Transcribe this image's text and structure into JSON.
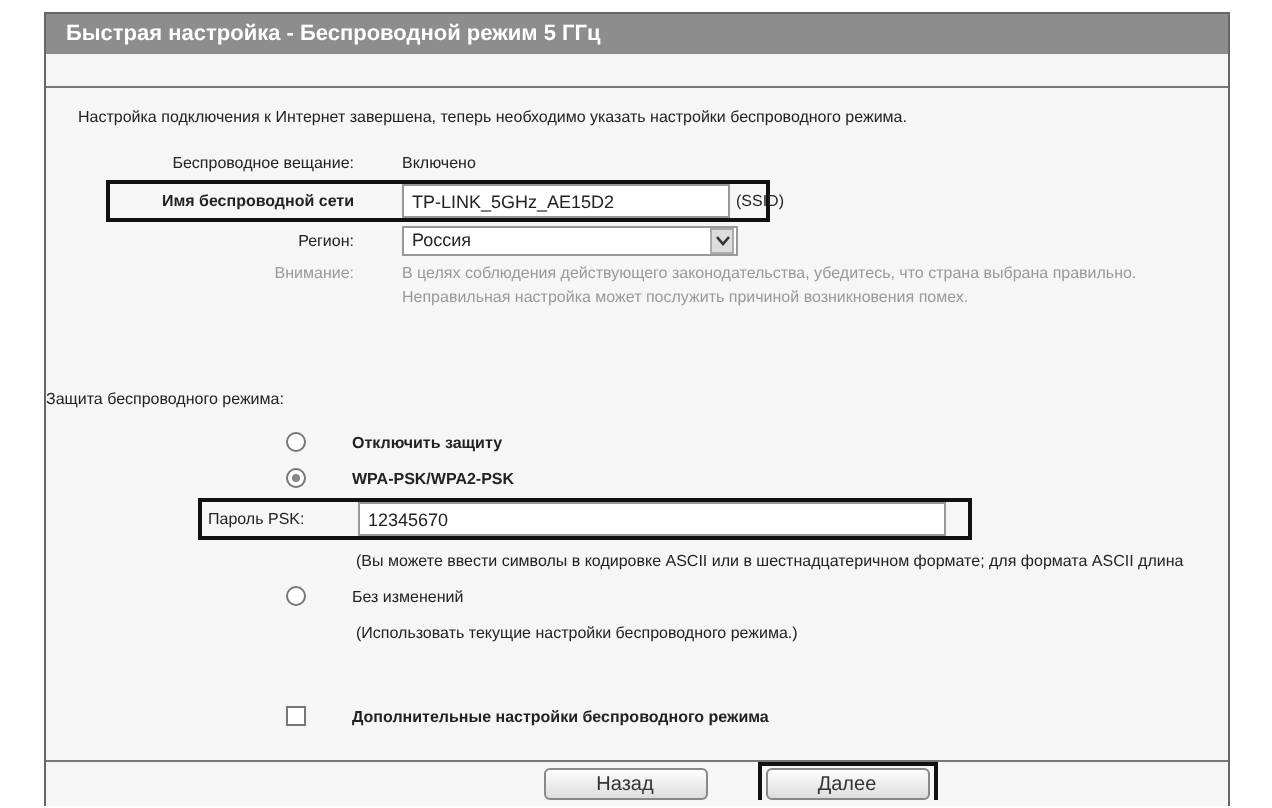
{
  "window": {
    "title": "Быстрая настройка - Беспроводной режим 5 ГГц"
  },
  "intro": "Настройка подключения к Интернет завершена, теперь необходимо указать настройки беспроводного режима.",
  "settings": [
    {
      "kind": "text",
      "label": "Беспроводное вещание:",
      "value": "Включено",
      "highlighted": false
    },
    {
      "kind": "input",
      "label": "Имя беспроводной сети",
      "value": "TP-LINK_5GHz_AE15D2",
      "suffix": "(SSID)",
      "highlighted": true
    },
    {
      "kind": "select",
      "label": "Регион:",
      "value": "Россия",
      "highlighted": false
    },
    {
      "kind": "note",
      "label": "Внимание:",
      "lines": [
        "В целях соблюдения действующего законодательства, убедитесь, что страна выбрана правильно.",
        "Неправильная настройка может послужить причиной возникновения помех."
      ],
      "highlighted": false
    }
  ],
  "security": {
    "title": "Защита беспроводного режима:",
    "items": [
      {
        "kind": "radio",
        "label": "Отключить защиту",
        "selected": false
      },
      {
        "kind": "radio",
        "label": "WPA-PSK/WPA2-PSK",
        "selected": true
      },
      {
        "kind": "input",
        "label": "Пароль PSK:",
        "value": "12345670",
        "highlighted": true
      },
      {
        "kind": "hint",
        "text": "(Вы можете ввести символы в кодировке ASCII или в шестнадцатеричном формате; для формата ASCII длина"
      },
      {
        "kind": "radio",
        "label": "Без изменений",
        "selected": false
      },
      {
        "kind": "hint",
        "text": "(Использовать текущие настройки беспроводного режима.)"
      },
      {
        "kind": "checkbox",
        "label": "Дополнительные настройки беспроводного режима",
        "checked": false
      }
    ]
  },
  "buttons": [
    {
      "label": "Назад",
      "highlighted": false
    },
    {
      "label": "Далее",
      "highlighted": true
    }
  ]
}
